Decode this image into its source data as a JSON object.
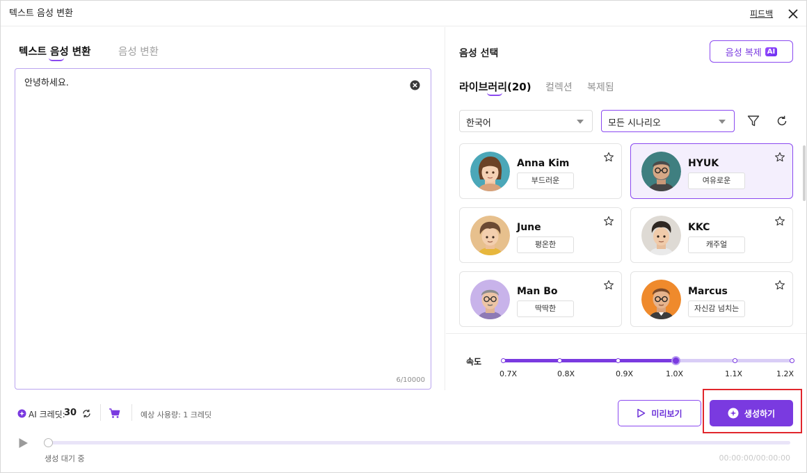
{
  "titlebar": {
    "title": "텍스트 음성 변환",
    "feedback": "피드백"
  },
  "left": {
    "tabs": [
      {
        "label": "텍스트 음성 변환",
        "active": true
      },
      {
        "label": "음성 변환",
        "active": false
      }
    ],
    "text_value": "안녕하세요.",
    "char_count": "6/10000"
  },
  "right": {
    "title": "음성 선택",
    "clone_button": {
      "label": "음성 복제",
      "badge": "AI"
    },
    "library_tabs": [
      {
        "label": "라이브러리(20)",
        "active": true
      },
      {
        "label": "컬렉션",
        "active": false
      },
      {
        "label": "복제됨",
        "active": false
      }
    ],
    "language_select": "한국어",
    "scenario_select": "모든 시나리오",
    "voices": [
      {
        "name": "Anna Kim",
        "tag": "부드러운",
        "selected": false
      },
      {
        "name": "HYUK",
        "tag": "여유로운",
        "selected": true
      },
      {
        "name": "June",
        "tag": "평온한",
        "selected": false
      },
      {
        "name": "KKC",
        "tag": "캐주얼",
        "selected": false
      },
      {
        "name": "Man Bo",
        "tag": "딱딱한",
        "selected": false
      },
      {
        "name": "Marcus",
        "tag": "자신감 넘치는",
        "selected": false
      }
    ],
    "speed": {
      "label": "속도",
      "ticks": [
        "0.7X",
        "0.8X",
        "0.9X",
        "1.0X",
        "1.1X",
        "1.2X"
      ],
      "value": "1.0X"
    }
  },
  "bottom": {
    "credit_label": "AI 크레딧:",
    "credit_value": "30",
    "expected_usage": "예상 사용량: 1 크레딧",
    "preview_label": "미리보기",
    "generate_label": "생성하기",
    "status": "생성 대기 중",
    "time": "00:00:00/00:00:00"
  },
  "colors": {
    "accent": "#7a3ae0",
    "highlight_frame": "#e1262c"
  }
}
